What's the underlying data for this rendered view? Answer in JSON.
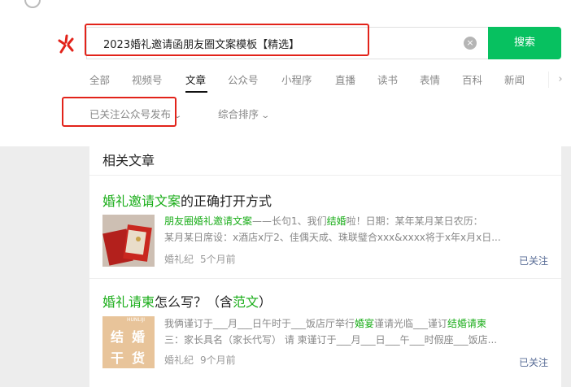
{
  "search": {
    "query": "2023婚礼邀请函朋友圈文案模板【精选】",
    "button_label": "搜索",
    "clear_icon": "×"
  },
  "tabs": [
    {
      "label": "全部"
    },
    {
      "label": "视频号"
    },
    {
      "label": "文章"
    },
    {
      "label": "公众号"
    },
    {
      "label": "小程序"
    },
    {
      "label": "直播"
    },
    {
      "label": "读书"
    },
    {
      "label": "表情"
    },
    {
      "label": "百科"
    },
    {
      "label": "新闻"
    }
  ],
  "active_tab": "文章",
  "tabs_more_icon": "›",
  "filters": {
    "source_label": "已关注公众号发布",
    "sort_label": "综合排序",
    "chevron": "⌄"
  },
  "section_title": "相关文章",
  "articles": [
    {
      "title_hl": "婚礼邀请文案",
      "title_rest": "的正确打开方式",
      "snippet_line1_hl": "朋友圈婚礼邀请文案",
      "snippet_line1_rest": "——长句1、我们",
      "snippet_line1_hl2": "结婚",
      "snippet_line1_rest2": "啦！日期：某年某月某日农历：",
      "snippet_line2": "某月某日席设：x酒店x厅2、佳偶天成、珠联璧合xxx&xxxx将于x年x月x日...",
      "source": "婚礼纪",
      "time": "5个月前",
      "followed": "已关注"
    },
    {
      "title_hl": "婚礼请柬",
      "title_rest": "怎么写？（含",
      "title_hl2": "范文",
      "title_rest2": "）",
      "snippet_line1_pre": "我俩谨订于___月___日午时于___饭店厅举行",
      "snippet_line1_hl": "婚宴",
      "snippet_line1_mid": "谨请光临___谨订",
      "snippet_line1_hl2": "结婚请柬",
      "snippet_line2": "三：家长具名（家长代写） 请 柬谨订于___月___日___午___时假座___饭店...",
      "thumb_text": [
        "结",
        "婚",
        "干",
        "货"
      ],
      "thumb_brand": "HUNLIJI",
      "source": "婚礼纪",
      "time": "9个月前",
      "followed": "已关注"
    }
  ],
  "colors": {
    "brand_green": "#07c160",
    "highlight_green": "#1aad19",
    "annotation_red": "#e2231a",
    "link_blue": "#576b95"
  }
}
